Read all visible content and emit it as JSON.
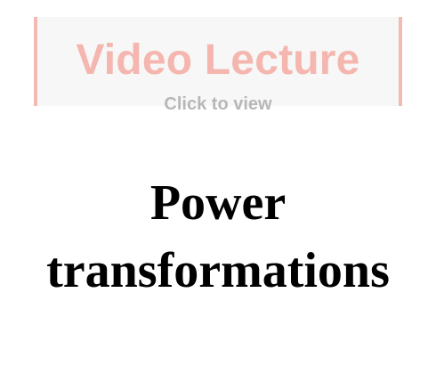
{
  "video_card": {
    "title": "Video Lecture",
    "subtitle": "Click to view",
    "accent_color": "#f4b6ae",
    "background_color": "#f7f7f7",
    "subtitle_color": "#b7b7b7"
  },
  "page": {
    "title_line1": "Power",
    "title_line2": "transformations"
  }
}
